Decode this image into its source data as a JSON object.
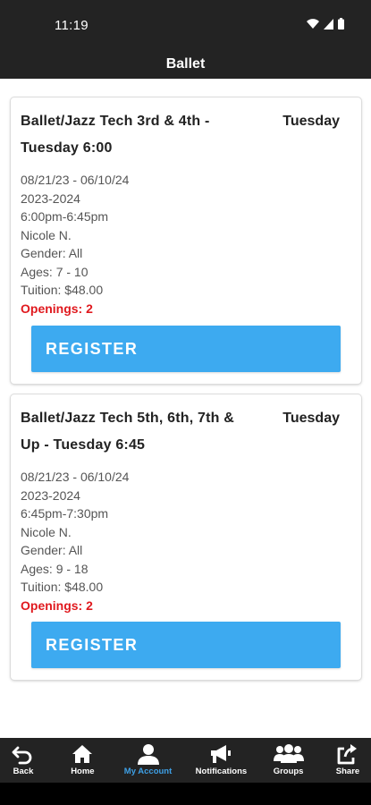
{
  "status_bar": {
    "time": "11:19"
  },
  "header": {
    "title": "Ballet"
  },
  "classes": [
    {
      "title": "Ballet/Jazz Tech 3rd & 4th - Tuesday 6:00",
      "day": "Tuesday",
      "dates": "08/21/23 - 06/10/24",
      "season": "2023-2024",
      "time": "6:00pm-6:45pm",
      "instructor": "Nicole N.",
      "gender": "Gender: All",
      "ages": "Ages: 7 - 10",
      "tuition": "Tuition: $48.00",
      "openings": "Openings: 2",
      "register_label": "REGISTER"
    },
    {
      "title": "Ballet/Jazz Tech 5th, 6th, 7th & Up - Tuesday 6:45",
      "day": "Tuesday",
      "dates": "08/21/23 - 06/10/24",
      "season": "2023-2024",
      "time": "6:45pm-7:30pm",
      "instructor": "Nicole N.",
      "gender": "Gender: All",
      "ages": "Ages: 9 - 18",
      "tuition": "Tuition: $48.00",
      "openings": "Openings: 2",
      "register_label": "REGISTER"
    }
  ],
  "bottom_nav": {
    "items": [
      {
        "label": "Back",
        "icon": "back-icon"
      },
      {
        "label": "Home",
        "icon": "home-icon"
      },
      {
        "label": "My Account",
        "icon": "account-icon",
        "active": true
      },
      {
        "label": "Notifications",
        "icon": "megaphone-icon"
      },
      {
        "label": "Groups",
        "icon": "groups-icon"
      },
      {
        "label": "Share",
        "icon": "share-icon"
      }
    ]
  },
  "colors": {
    "bar_background": "#232323",
    "button": "#3daaf0",
    "openings": "#e0191e",
    "active_nav": "#3ea0e6"
  }
}
